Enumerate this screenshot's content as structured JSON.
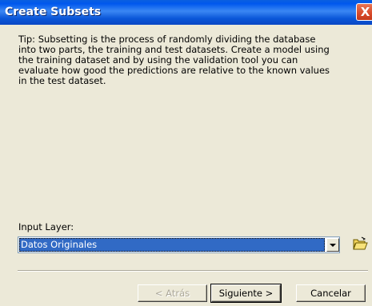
{
  "window": {
    "title": "Create Subsets",
    "close_glyph": "X"
  },
  "tip": {
    "text": "Tip:  Subsetting is the process of randomly dividing the database\ninto  two parts, the training and test datasets. Create a model using\nthe training dataset and by using the validation tool you can\nevaluate how good the predictions are relative to the known values\nin the test dataset."
  },
  "input_layer": {
    "label": "Input Layer:",
    "selected": "Datos Originales",
    "browse_icon": "open-folder-icon"
  },
  "buttons": {
    "back": "< Atrás",
    "next": "Siguiente >",
    "cancel": "Cancelar"
  },
  "colors": {
    "titlebar": "#0058ee",
    "close": "#d84a2a",
    "selection": "#316ac5",
    "dialog_bg": "#ece9d8"
  }
}
